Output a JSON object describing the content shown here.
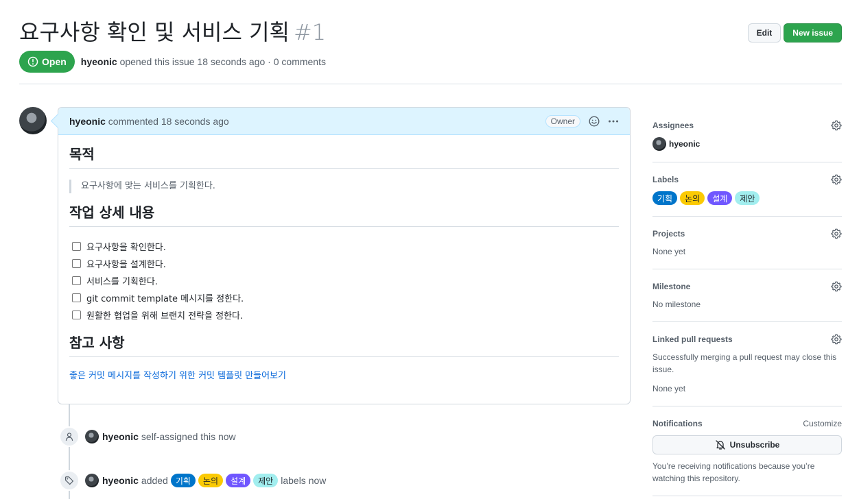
{
  "issue": {
    "title": "요구사항 확인 및 서비스 기획",
    "number": "#1",
    "state": "Open",
    "author": "hyeonic",
    "meta": "opened this issue 18 seconds ago · 0 comments"
  },
  "header": {
    "edit_label": "Edit",
    "new_issue_label": "New issue"
  },
  "comment": {
    "author": "hyeonic",
    "time": "commented 18 seconds ago",
    "role": "Owner",
    "h_purpose": "목적",
    "quote": "요구사항에 맞는 서비스를 기획한다.",
    "h_details": "작업 상세 내용",
    "tasks": [
      "요구사항을 확인한다.",
      "요구사항을 설계한다.",
      "서비스를 기획한다.",
      "git commit template 메시지를 정한다.",
      "원활한 협업을 위해 브랜치 전략을 정한다."
    ],
    "h_refs": "참고 사항",
    "ref_link": "좋은 커밋 메시지를 작성하기 위한 커밋 템플릿 만들어보기"
  },
  "labels": [
    {
      "name": "기획",
      "color": "#0075ca",
      "text": "dark"
    },
    {
      "name": "논의",
      "color": "#fbca04",
      "text": "light"
    },
    {
      "name": "설계",
      "color": "#7057ff",
      "text": "dark"
    },
    {
      "name": "제안",
      "color": "#a2eeef",
      "text": "light"
    }
  ],
  "timeline": {
    "assign": {
      "actor": "hyeonic",
      "text": "self-assigned this now"
    },
    "labeled": {
      "actor": "hyeonic",
      "verb": "added",
      "suffix": "labels now"
    }
  },
  "sidebar": {
    "assignees": {
      "heading": "Assignees",
      "user": "hyeonic"
    },
    "labels": {
      "heading": "Labels"
    },
    "projects": {
      "heading": "Projects",
      "value": "None yet"
    },
    "milestone": {
      "heading": "Milestone",
      "value": "No milestone"
    },
    "linked": {
      "heading": "Linked pull requests",
      "description": "Successfully merging a pull request may close this issue.",
      "value": "None yet"
    },
    "notifications": {
      "heading": "Notifications",
      "customize": "Customize",
      "button": "Unsubscribe",
      "note": "You’re receiving notifications because you’re watching this repository."
    }
  },
  "icons": [
    "issue-opened-icon",
    "smiley-icon",
    "kebab-horizontal-icon",
    "person-icon",
    "tag-icon",
    "gear-icon",
    "bell-slash-icon"
  ]
}
